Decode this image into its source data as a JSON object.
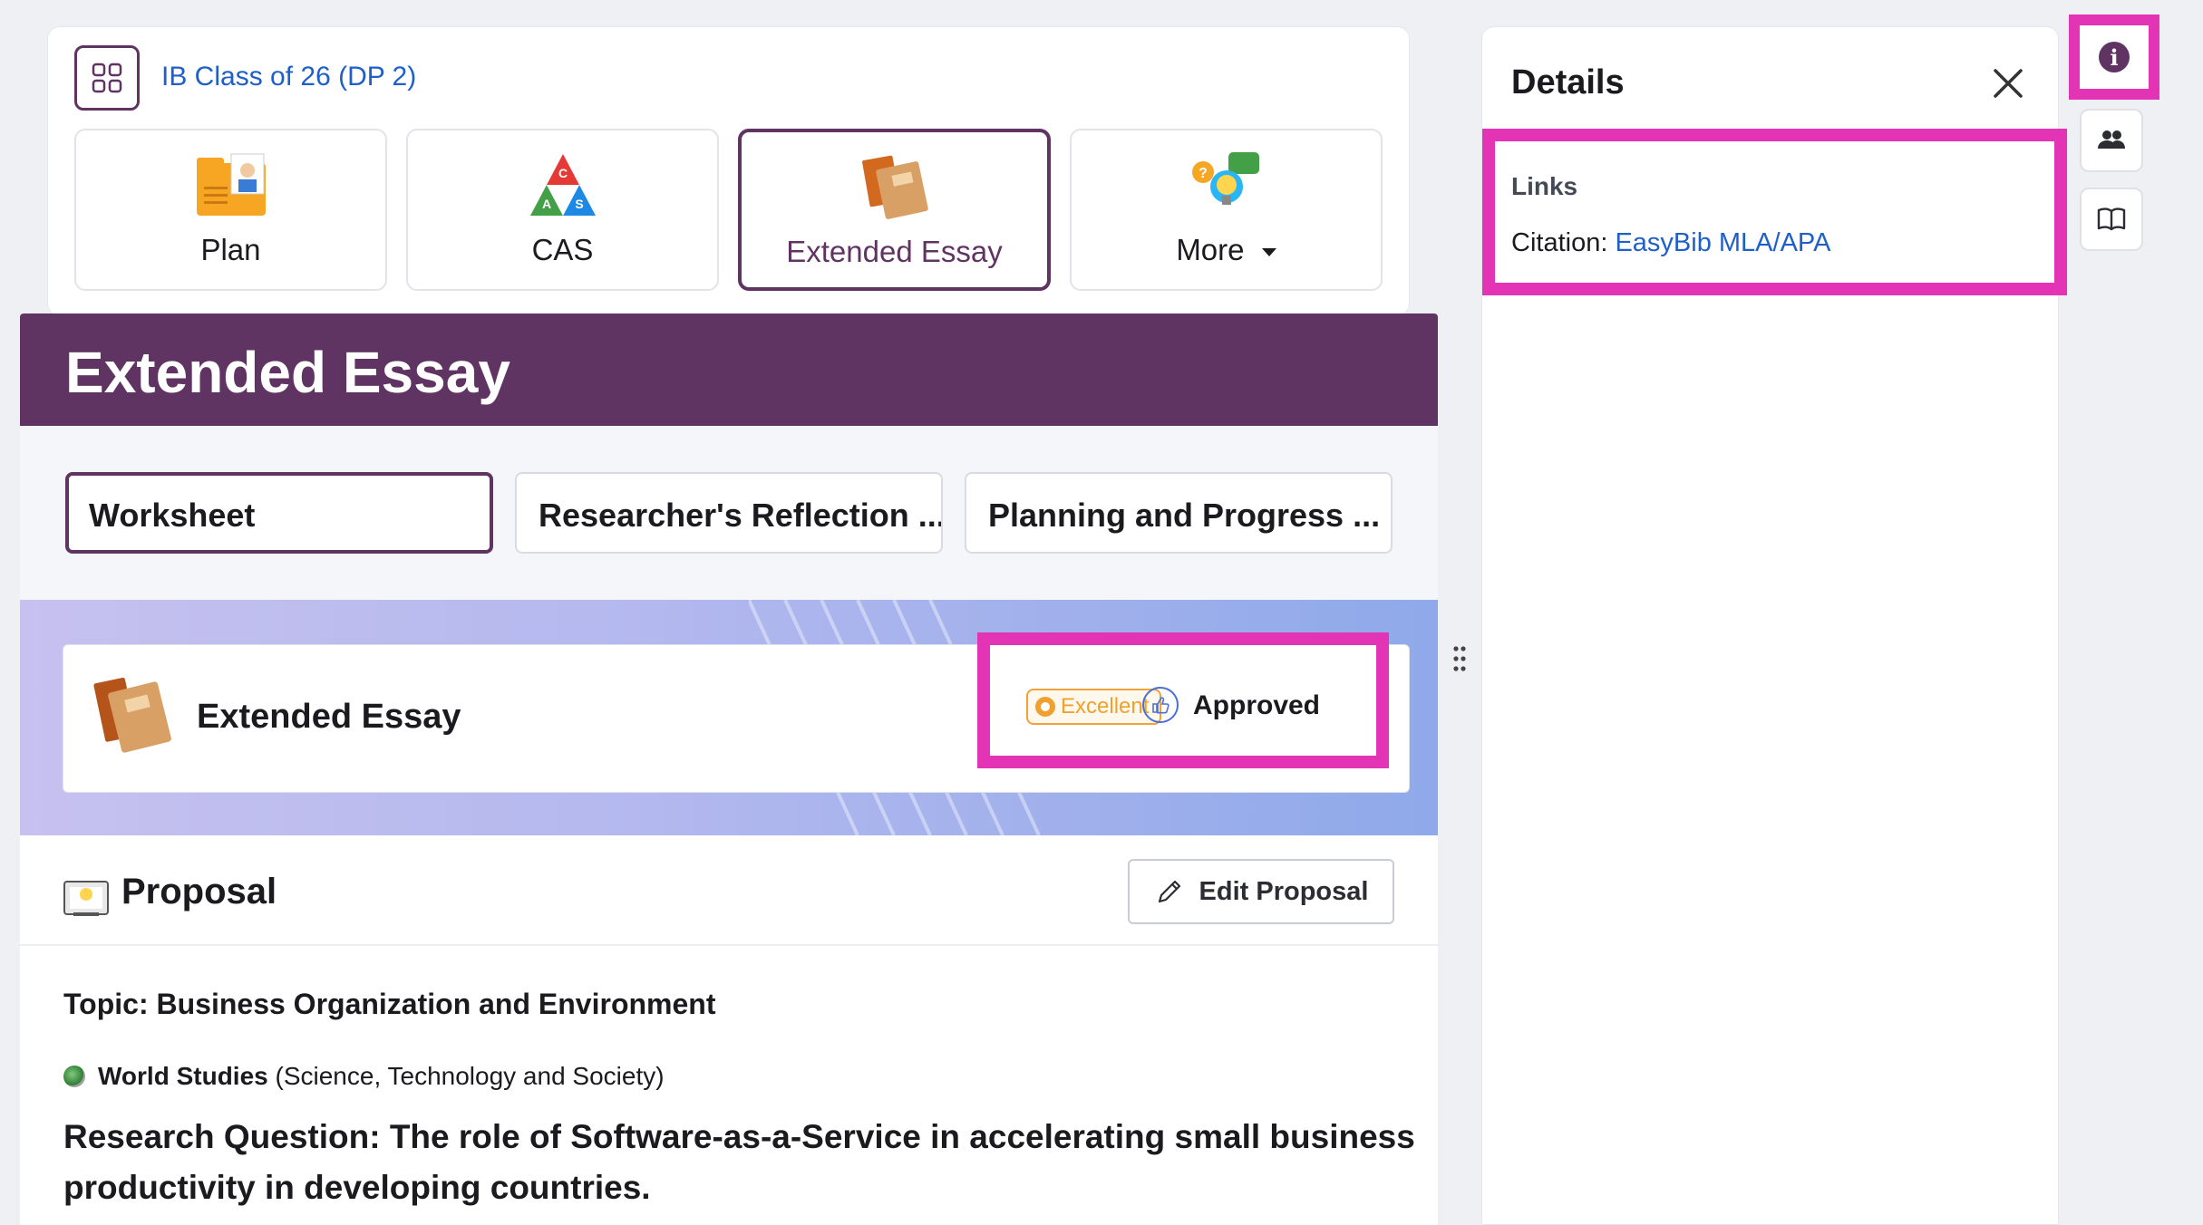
{
  "class_selector": {
    "label": "IB Class of 26 (DP 2)",
    "icon": "grid-icon"
  },
  "tiles": [
    {
      "label": "Plan",
      "icon": "plan-folder-icon"
    },
    {
      "label": "CAS",
      "icon": "cas-triangle-icon",
      "letters": [
        "C",
        "A",
        "S"
      ]
    },
    {
      "label": "Extended Essay",
      "icon": "extended-essay-books-icon",
      "active": true
    },
    {
      "label": "More",
      "icon": "more-lightbulb-icon",
      "dropdown": true
    }
  ],
  "banner": {
    "title": "Extended Essay",
    "color": "#5f3462"
  },
  "worksheet_tabs": [
    {
      "label": "Worksheet",
      "active": true
    },
    {
      "label": "Researcher's Reflection ..."
    },
    {
      "label": "Planning and Progress ..."
    }
  ],
  "ee_card": {
    "title": "Extended Essay",
    "grade_badge": "Excellent",
    "status": "Approved"
  },
  "proposal": {
    "title": "Proposal",
    "edit_button": "Edit Proposal",
    "topic": "Topic: Business Organization and Environment",
    "subject_name": "World Studies",
    "subject_detail": "(Science, Technology and Society)",
    "research_question": "Research Question: The role of Software-as-a-Service in accelerating small business productivity in developing countries."
  },
  "details": {
    "title": "Details",
    "links_label": "Links",
    "citation_label": "Citation:",
    "citation_link": "EasyBib MLA/APA"
  },
  "rail": [
    {
      "icon": "info-icon",
      "glyph": "i",
      "highlighted": true
    },
    {
      "icon": "people-icon"
    },
    {
      "icon": "book-icon"
    }
  ],
  "colors": {
    "brand": "#5f3462",
    "highlight": "#e434b6",
    "link": "#1f5fc8",
    "excellent": "#f0a02e"
  }
}
